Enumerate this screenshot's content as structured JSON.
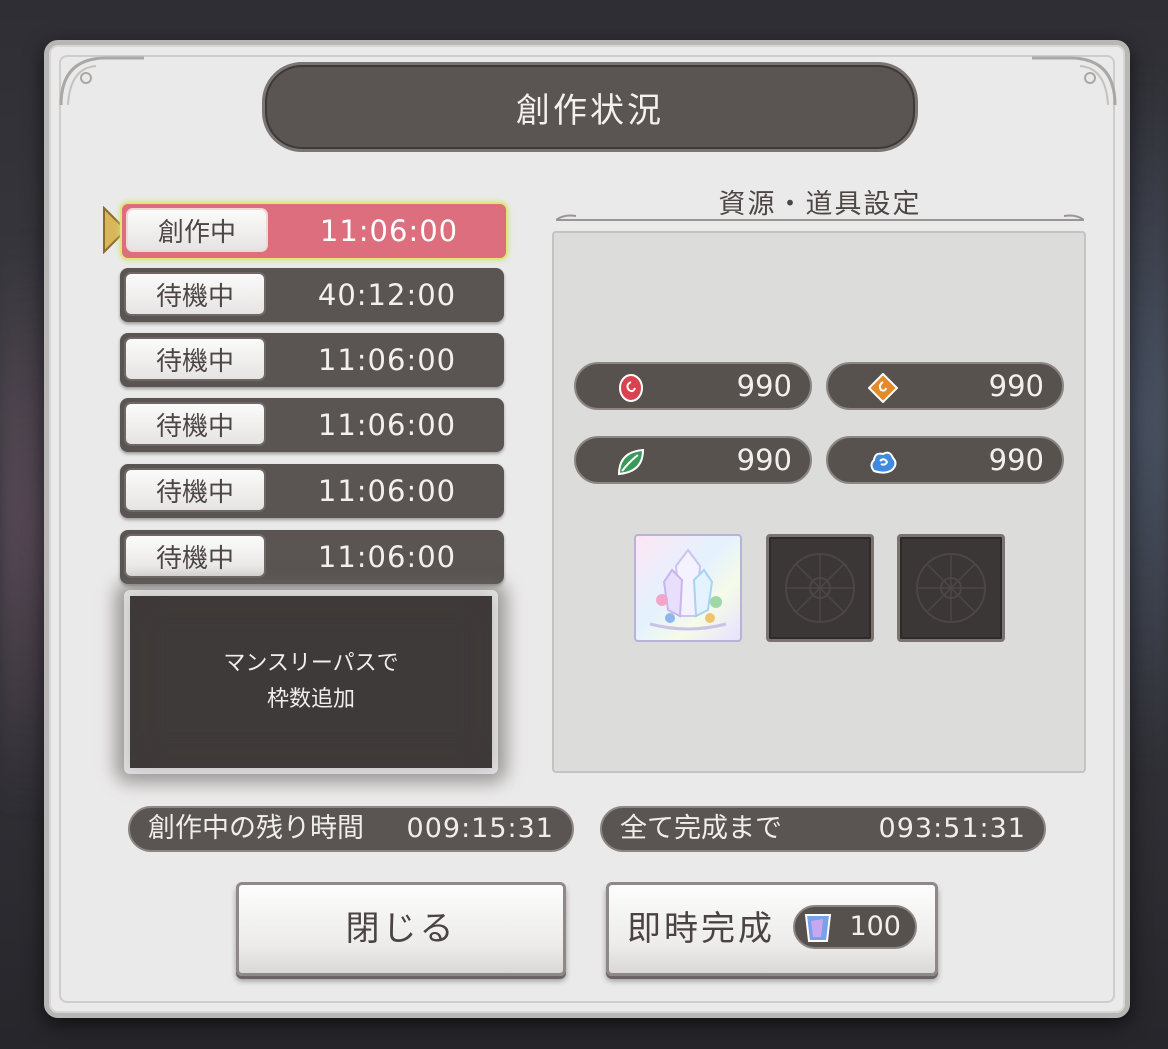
{
  "window": {
    "title": "創作状況"
  },
  "slots": [
    {
      "status": "創作中",
      "time": "11:06:00",
      "active": true
    },
    {
      "status": "待機中",
      "time": "40:12:00",
      "active": false
    },
    {
      "status": "待機中",
      "time": "11:06:00",
      "active": false
    },
    {
      "status": "待機中",
      "time": "11:06:00",
      "active": false
    },
    {
      "status": "待機中",
      "time": "11:06:00",
      "active": false
    },
    {
      "status": "待機中",
      "time": "11:06:00",
      "active": false
    }
  ],
  "monthly_pass": {
    "line1": "マンスリーパスで",
    "line2": "枠数追加"
  },
  "resources": {
    "title": "資源・道具設定",
    "items": [
      {
        "icon": "red-swirl-icon",
        "value": "990",
        "color": "#d9434f"
      },
      {
        "icon": "orange-diamond-icon",
        "value": "990",
        "color": "#e38a2a"
      },
      {
        "icon": "green-leaf-icon",
        "value": "990",
        "color": "#3a9a5a"
      },
      {
        "icon": "blue-cloud-icon",
        "value": "990",
        "color": "#3f8be0"
      }
    ],
    "tools": [
      {
        "icon": "rainbow-crystal-icon",
        "filled": true
      },
      {
        "icon": "empty-slot-icon",
        "filled": false
      },
      {
        "icon": "empty-slot-icon",
        "filled": false
      }
    ]
  },
  "status": {
    "remaining_label": "創作中の残り時間",
    "remaining_value": "009:15:31",
    "complete_label": "全て完成まで",
    "complete_value": "093:51:31"
  },
  "buttons": {
    "close_label": "閉じる",
    "instant_label": "即時完成",
    "instant_cost": "100",
    "instant_cost_icon": "potion-bottle-icon"
  }
}
